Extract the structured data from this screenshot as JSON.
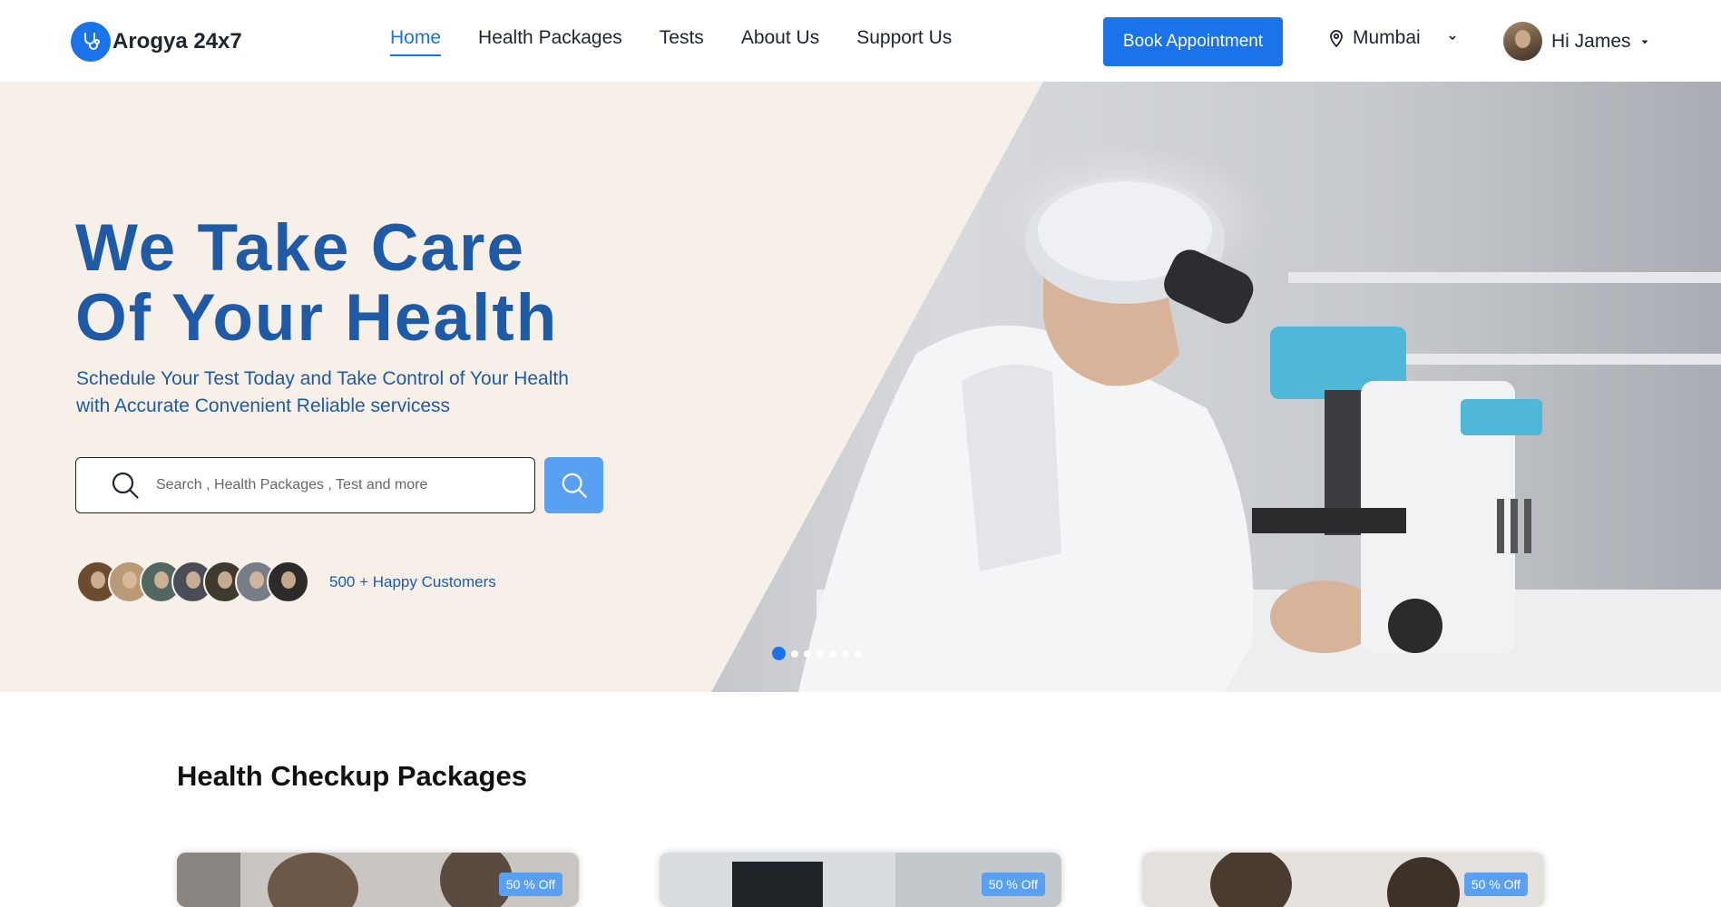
{
  "brand": {
    "name": "Arogya 24x7",
    "accent": "#1a73e8"
  },
  "nav": {
    "items": [
      {
        "label": "Home",
        "active": true
      },
      {
        "label": "Health Packages",
        "active": false
      },
      {
        "label": "Tests",
        "active": false
      },
      {
        "label": "About Us",
        "active": false
      },
      {
        "label": "Support Us",
        "active": false
      }
    ]
  },
  "header": {
    "book_label": "Book Appointment",
    "location": "Mumbai",
    "greeting": "Hi James"
  },
  "hero": {
    "title_line1": "We Take Care",
    "title_line2": "Of Your Health",
    "subtitle_line1": "Schedule Your Test Today and Take Control of Your Health",
    "subtitle_line2": "with Accurate Convenient Reliable servicess",
    "search_placeholder": "Search , Health Packages , Test and more",
    "customers_text": "500 + Happy Customers",
    "slide_count": 7,
    "active_slide": 1
  },
  "packages": {
    "title": "Health Checkup Packages",
    "cards": [
      {
        "badge": "50 % Off"
      },
      {
        "badge": "50 % Off"
      },
      {
        "badge": "50 % Off"
      }
    ]
  },
  "colors": {
    "hero_bg": "#f7f0e8",
    "hero_text": "#1f5aa6",
    "search_button": "#5aa0f2"
  }
}
